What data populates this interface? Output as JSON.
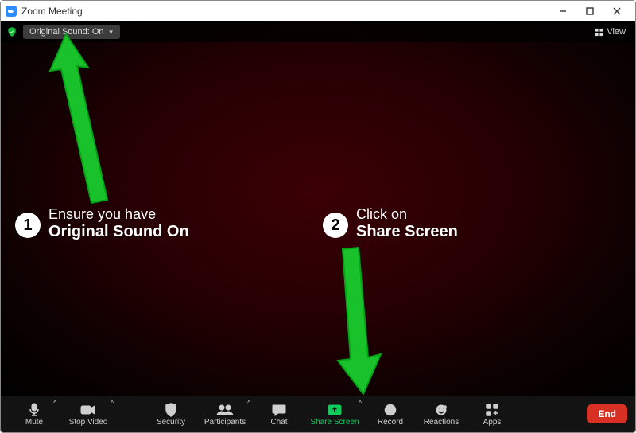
{
  "title": "Zoom Meeting",
  "topbar": {
    "original_sound_label": "Original Sound: On",
    "view_label": "View"
  },
  "annotations": {
    "step1": {
      "num": "1",
      "line1": "Ensure you have",
      "line2": "Original Sound On"
    },
    "step2": {
      "num": "2",
      "line1": "Click on",
      "line2": "Share Screen"
    }
  },
  "toolbar": {
    "mute": "Mute",
    "stop_video": "Stop Video",
    "security": "Security",
    "participants": "Participants",
    "chat": "Chat",
    "share_screen": "Share Screen",
    "record": "Record",
    "reactions": "Reactions",
    "apps": "Apps",
    "end": "End"
  },
  "colors": {
    "accent_green": "#19c22a",
    "share_green": "#0ecb5b",
    "end_red": "#d93025",
    "zoom_blue": "#2d8cff"
  }
}
